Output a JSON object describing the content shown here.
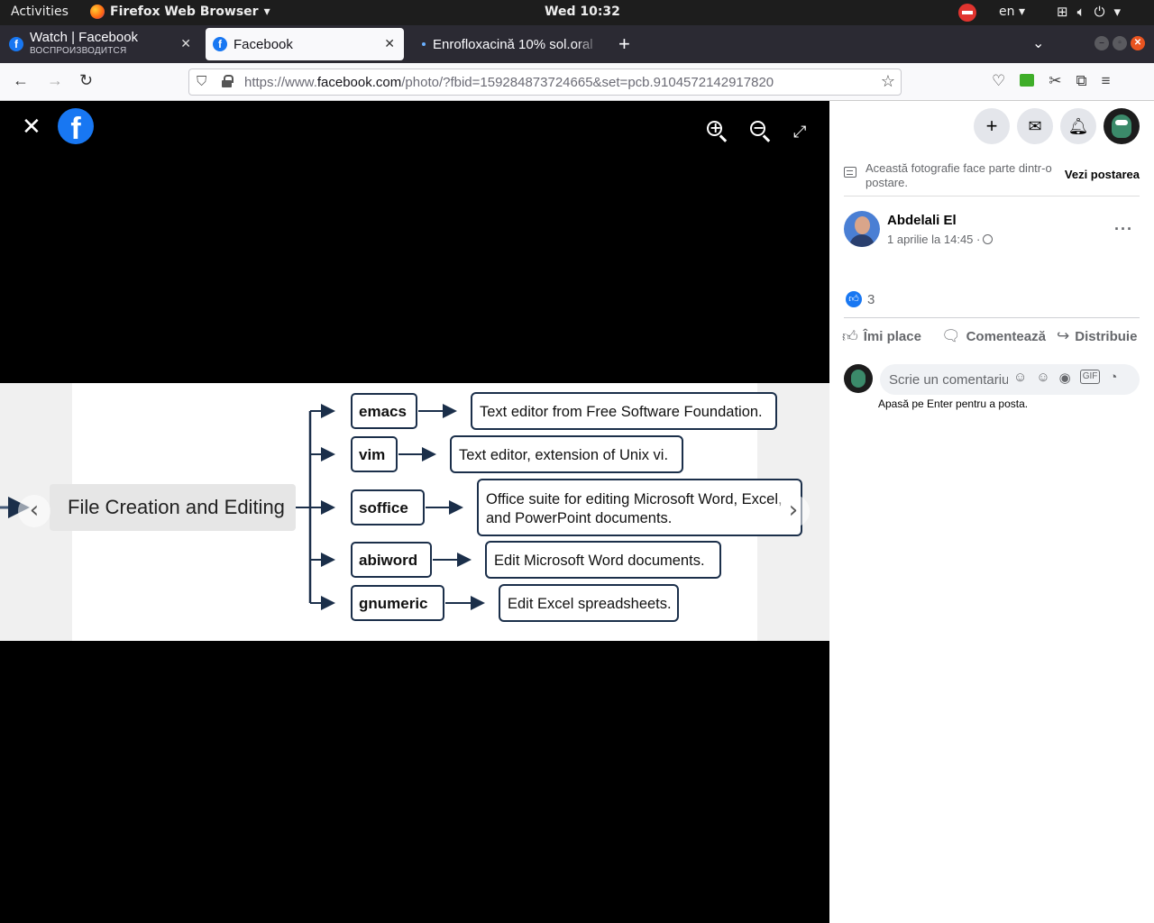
{
  "system_bar": {
    "activities": "Activities",
    "app_name": "Firefox Web Browser",
    "clock": "Wed 10:32",
    "language": "en"
  },
  "tabs": [
    {
      "title": "Watch | Facebook",
      "subtitle": "ВОСПРОИЗВОДИТСЯ",
      "favicon": "f",
      "active": false
    },
    {
      "title": "Facebook",
      "favicon": "f",
      "active": true
    },
    {
      "title": "Enrofloxacină 10% sol.oral",
      "active": false
    }
  ],
  "url_bar": {
    "prefix": "https://www.",
    "domain": "facebook.com",
    "path": "/photo/?fbid=159284873724665&set=pcb.9104572142917820"
  },
  "photo_diagram": {
    "root": "File Creation and Editing",
    "commands": [
      {
        "name": "emacs",
        "description": [
          "Text editor from Free Software Foundation."
        ]
      },
      {
        "name": "vim",
        "description": [
          "Text editor, extension of Unix vi."
        ]
      },
      {
        "name": "soffice",
        "description": [
          "Office suite for editing Microsoft Word, Excel,",
          "and PowerPoint documents."
        ]
      },
      {
        "name": "abiword",
        "description": [
          "Edit Microsoft Word documents."
        ]
      },
      {
        "name": "gnumeric",
        "description": [
          "Edit Excel spreadsheets."
        ]
      }
    ]
  },
  "panel": {
    "notice_text": "Această fotografie face parte dintr-o postare.",
    "notice_link": "Vezi postarea",
    "author": "Abdelali El",
    "date": "1 aprilie la 14:45 ·",
    "like_count": "3",
    "actions": {
      "like": "Îmi place",
      "comment": "Comentează",
      "share": "Distribuie"
    },
    "comment_placeholder": "Scrie un comentariu public...",
    "comment_hint": "Apasă pe Enter pentru a posta."
  },
  "colors": {
    "facebook_blue": "#1877f2",
    "diagram_stroke": "#1b2f4a"
  }
}
